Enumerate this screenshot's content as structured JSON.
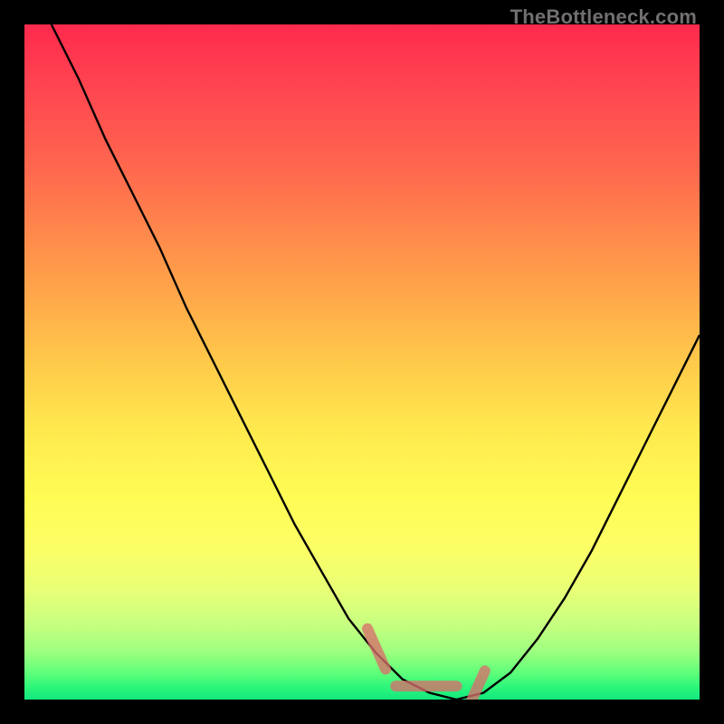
{
  "watermark": "TheBottleneck.com",
  "chart_data": {
    "type": "line",
    "title": "",
    "xlabel": "",
    "ylabel": "",
    "xlim": [
      0,
      100
    ],
    "ylim": [
      0,
      100
    ],
    "series": [
      {
        "name": "curve",
        "x": [
          4,
          8,
          12,
          16,
          20,
          24,
          28,
          32,
          36,
          40,
          44,
          48,
          52,
          56,
          60,
          64,
          68,
          72,
          76,
          80,
          84,
          88,
          92,
          96,
          100
        ],
        "y": [
          100,
          92,
          83,
          75,
          67,
          58,
          50,
          42,
          34,
          26,
          19,
          12,
          7,
          3,
          1,
          0,
          1,
          4,
          9,
          15,
          22,
          30,
          38,
          46,
          54
        ]
      }
    ],
    "highlight_range_x": [
      52,
      67
    ],
    "gradient_colors": {
      "top": "#ff2a4d",
      "bottom": "#12e87e"
    }
  }
}
